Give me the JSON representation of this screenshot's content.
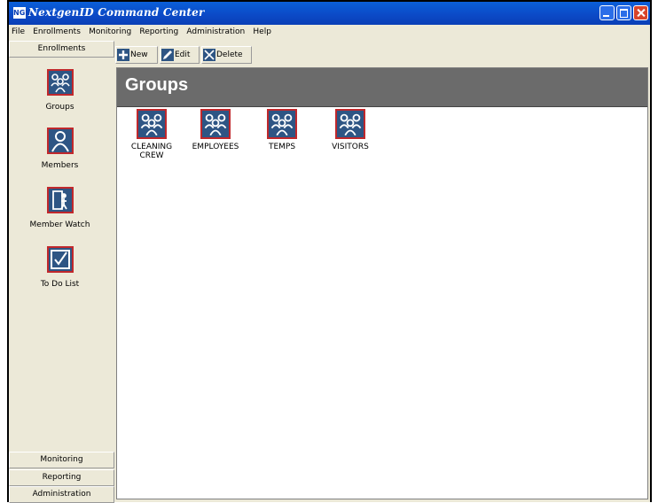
{
  "window": {
    "title": "NextgenID Command Center",
    "icon": "NGID"
  },
  "menu": [
    "File",
    "Enrollments",
    "Monitoring",
    "Reporting",
    "Administration",
    "Help"
  ],
  "sidebar": {
    "header": "Enrollments",
    "items": [
      {
        "label": "Groups",
        "icon": "groups-icon"
      },
      {
        "label": "Members",
        "icon": "member-icon"
      },
      {
        "label": "Member Watch",
        "icon": "member-watch-icon"
      },
      {
        "label": "To Do List",
        "icon": "checklist-icon"
      }
    ],
    "footer_categories": [
      "Monitoring",
      "Reporting",
      "Administration"
    ]
  },
  "toolbar": {
    "new_label": "New",
    "edit_label": "Edit",
    "delete_label": "Delete"
  },
  "main": {
    "title": "Groups",
    "groups": [
      "CLEANING CREW",
      "EMPLOYEES",
      "TEMPS",
      "VISITORS"
    ]
  },
  "colors": {
    "titlebar": "#0b49c6",
    "icon_bg": "#2e5584",
    "icon_border": "#c0282c",
    "header_bg": "#6b6b6b"
  }
}
